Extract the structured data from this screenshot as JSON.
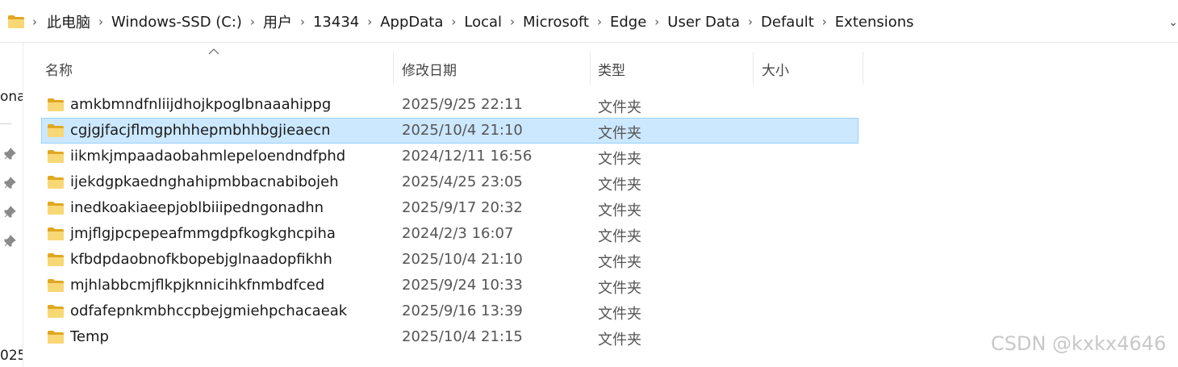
{
  "address_bar": {
    "folder_icon": "folder-icon",
    "crumbs": [
      "此电脑",
      "Windows-SSD (C:)",
      "用户",
      "13434",
      "AppData",
      "Local",
      "Microsoft",
      "Edge",
      "User Data",
      "Default",
      "Extensions"
    ],
    "dropdown_icon": "chevron-down-icon"
  },
  "nav": {
    "cut_top_text": "ona",
    "cut_bottom_text": "025",
    "pin_icon": "pin-icon"
  },
  "columns": {
    "name": "名称",
    "date": "修改日期",
    "type": "类型",
    "size": "大小"
  },
  "files": [
    {
      "name": "amkbmndfnliijdhojkpoglbnaaahippg",
      "date": "2025/9/25 22:11",
      "type": "文件夹",
      "selected": false
    },
    {
      "name": "cgjgjfacjflmgphhhepmbhhbgjieaecn",
      "date": "2025/10/4 21:10",
      "type": "文件夹",
      "selected": true
    },
    {
      "name": "iikmkjmpaadaobahmlepeloendndfphd",
      "date": "2024/12/11 16:56",
      "type": "文件夹",
      "selected": false
    },
    {
      "name": "ijekdgpkaednghahipmbbacnabibojeh",
      "date": "2025/4/25 23:05",
      "type": "文件夹",
      "selected": false
    },
    {
      "name": "inedkoakiaeepjoblbiiipedngonadhn",
      "date": "2025/9/17 20:32",
      "type": "文件夹",
      "selected": false
    },
    {
      "name": "jmjflgjpcpepeafmmgdpfkogkghcpiha",
      "date": "2024/2/3 16:07",
      "type": "文件夹",
      "selected": false
    },
    {
      "name": "kfbdpdaobnofkbopebjglnaadopfikhh",
      "date": "2025/10/4 21:10",
      "type": "文件夹",
      "selected": false
    },
    {
      "name": "mjhlabbcmjflkpjknnicihkfnmbdfced",
      "date": "2025/9/24 10:33",
      "type": "文件夹",
      "selected": false
    },
    {
      "name": "odfafepnkmbhccpbejgmiehpchacaeak",
      "date": "2025/9/16 13:39",
      "type": "文件夹",
      "selected": false
    },
    {
      "name": "Temp",
      "date": "2025/10/4 21:15",
      "type": "文件夹",
      "selected": false
    }
  ],
  "watermark": "CSDN @kxkx4646",
  "colors": {
    "selection_bg": "#cce8ff",
    "selection_border": "#99d1ff",
    "folder_yellow": "#f8d775",
    "folder_dark": "#e0a820"
  }
}
